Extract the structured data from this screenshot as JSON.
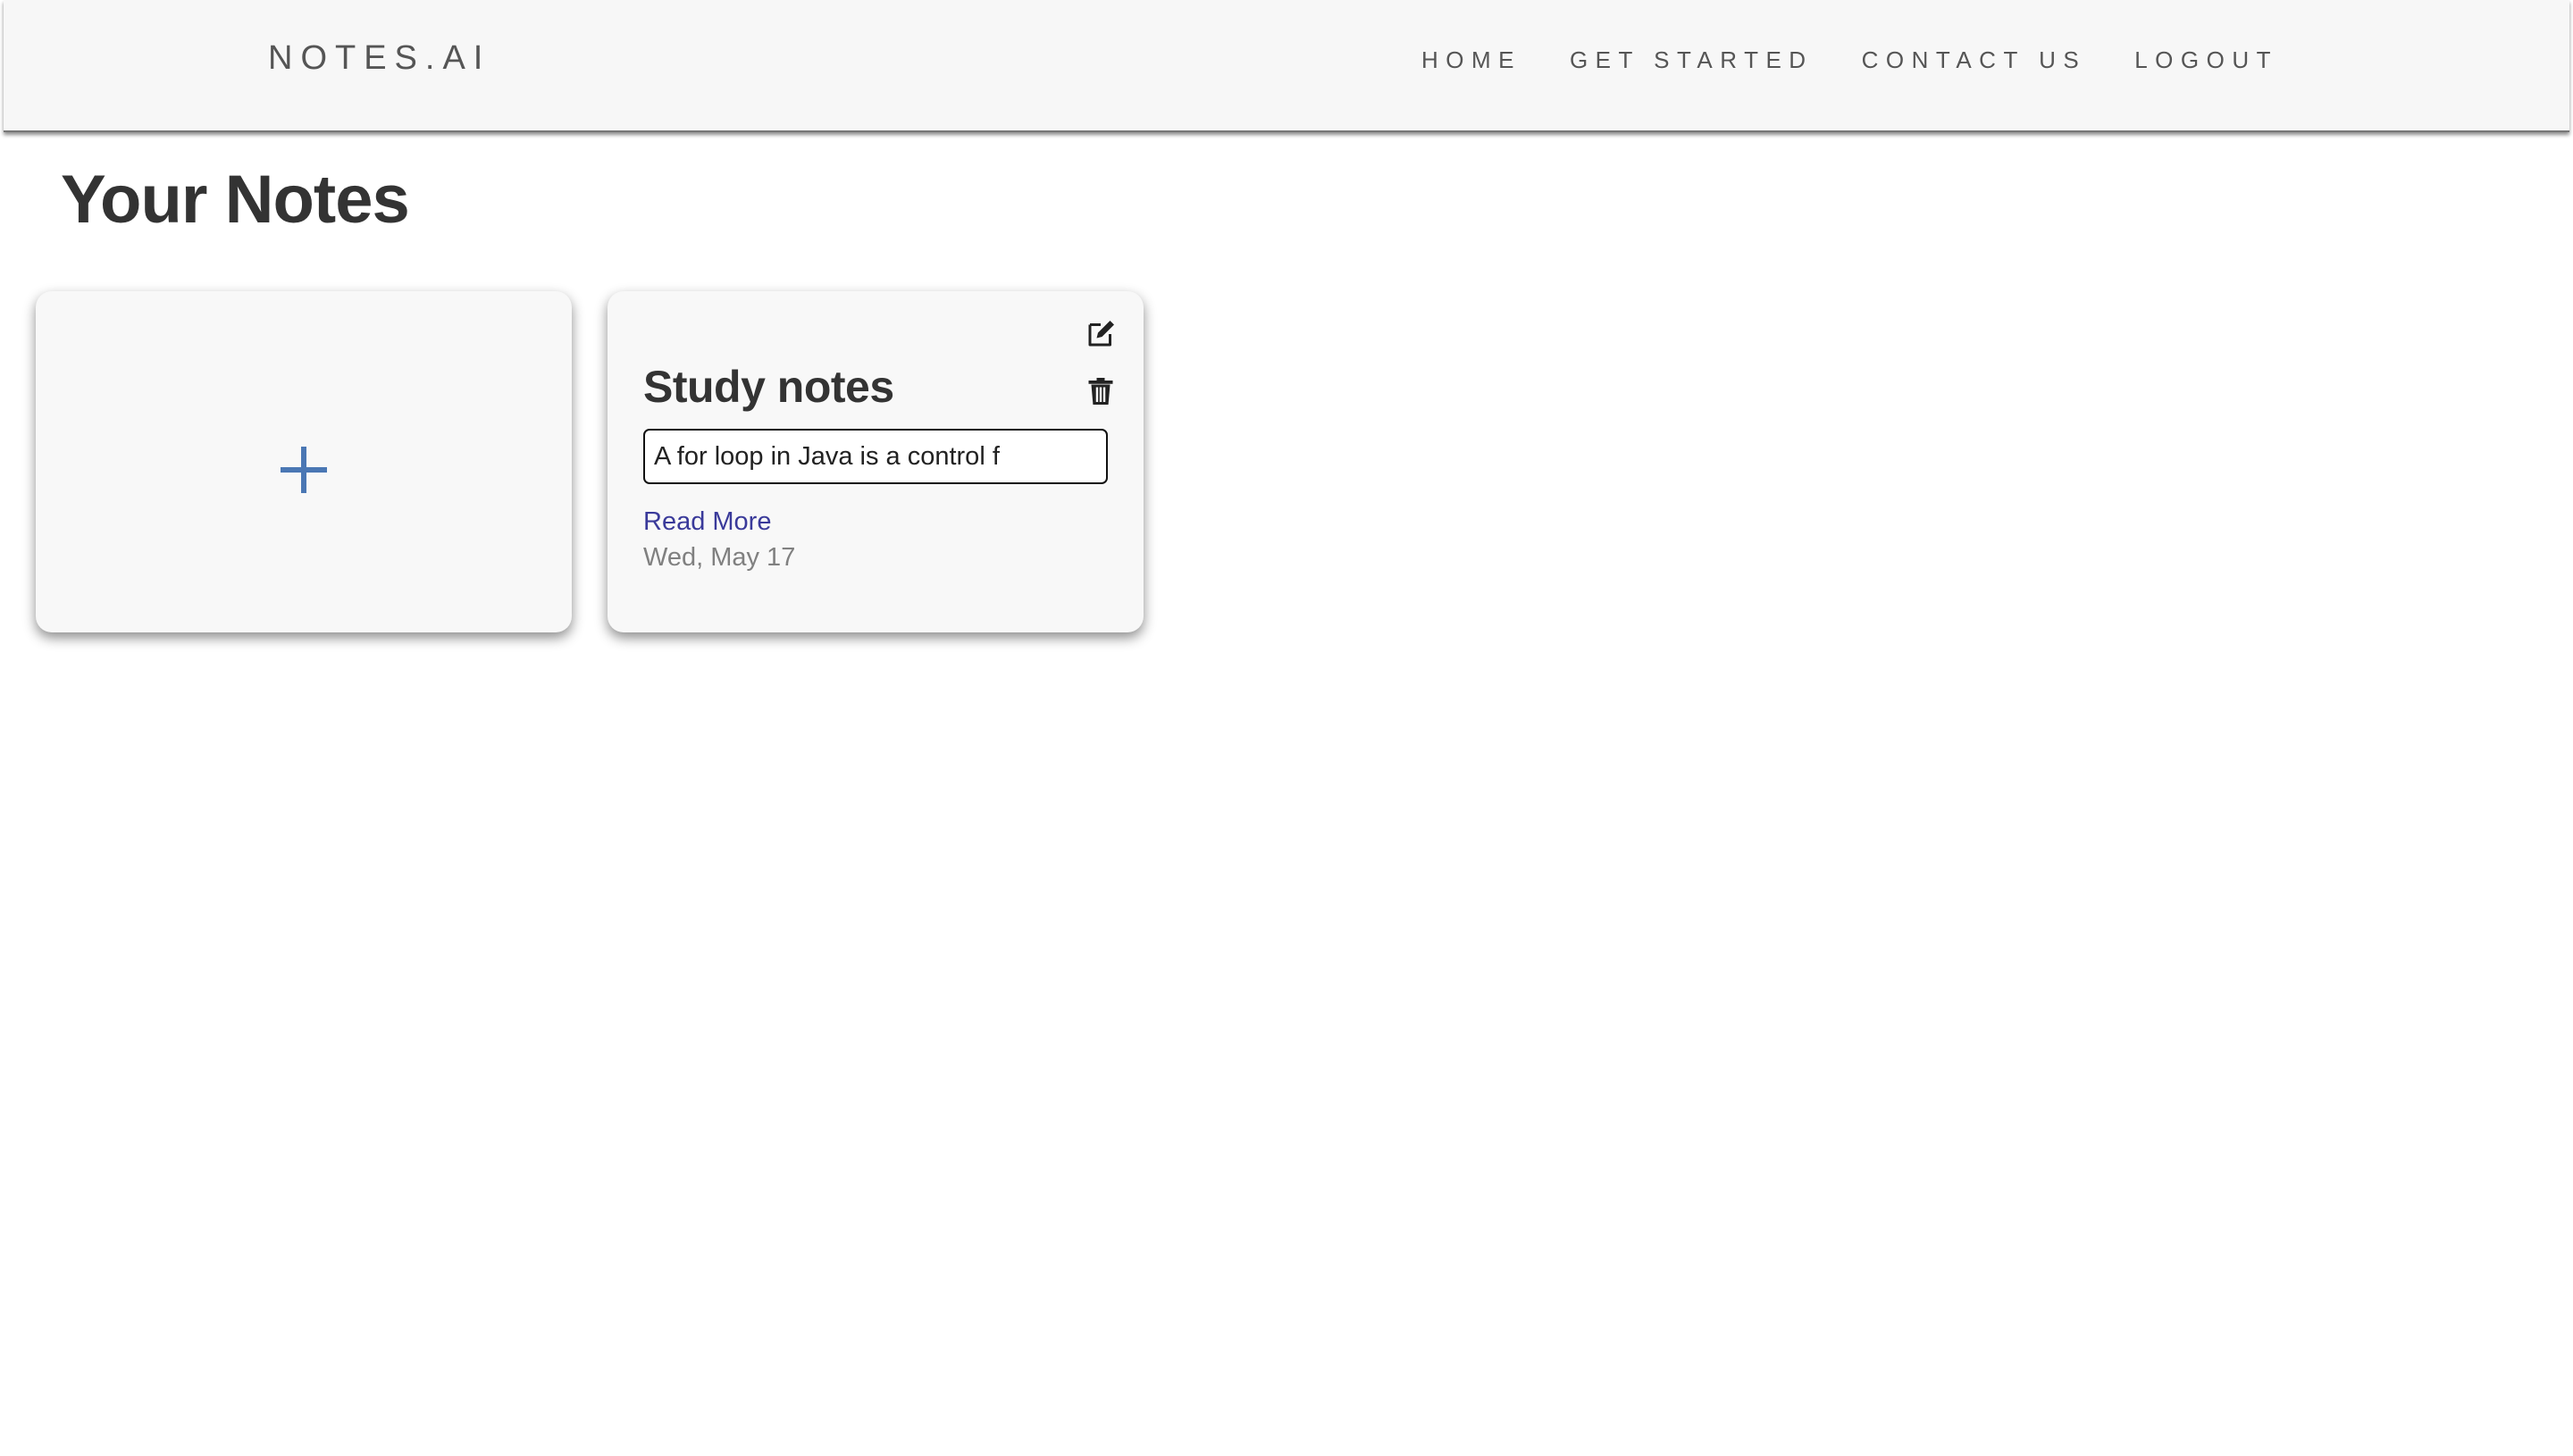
{
  "header": {
    "brand": "NOTES.AI",
    "nav": [
      {
        "label": "HOME"
      },
      {
        "label": "GET STARTED"
      },
      {
        "label": "CONTACT US"
      },
      {
        "label": "LOGOUT"
      }
    ]
  },
  "page": {
    "title": "Your Notes"
  },
  "add_card": {
    "icon": "plus-icon",
    "icon_color": "#4a77b4"
  },
  "notes": [
    {
      "title": "Study notes",
      "preview": "A for loop in Java is a control f",
      "read_more_label": "Read More",
      "date": "Wed, May 17",
      "edit_icon": "edit-icon",
      "delete_icon": "trash-icon"
    }
  ],
  "colors": {
    "navbar_bg": "#f7f7f7",
    "card_bg": "#f8f8f8",
    "link": "#3a3a9a",
    "muted_text": "#808080"
  }
}
